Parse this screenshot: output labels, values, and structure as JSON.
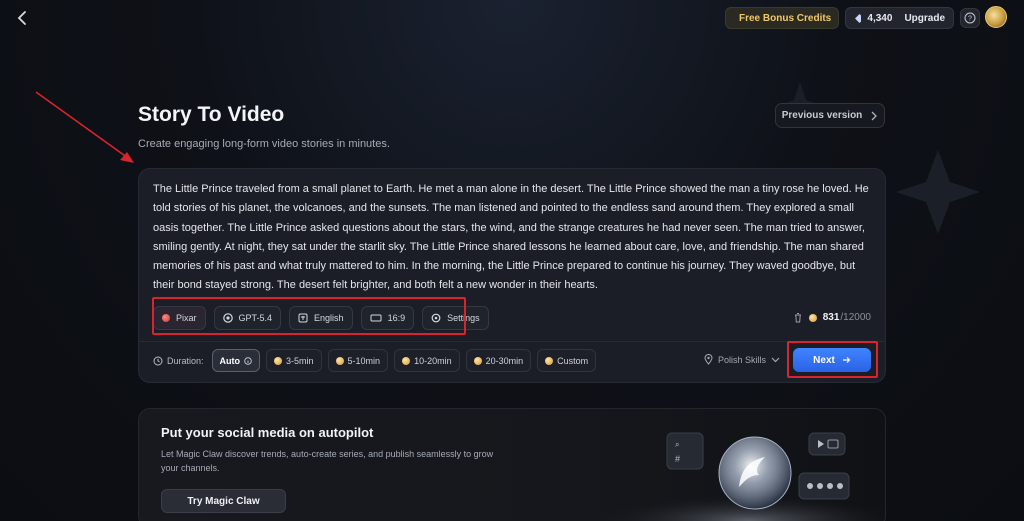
{
  "topbar": {
    "bonus_label": "Free Bonus Credits",
    "credits_value": "4,340",
    "upgrade_label": "Upgrade"
  },
  "header": {
    "title": "Story To Video",
    "subtitle": "Create engaging long-form video stories in minutes.",
    "previous_version_label": "Previous version"
  },
  "editor": {
    "story_text": "The Little Prince traveled from a small planet to Earth. He met a man alone in the desert. The Little Prince showed the man a tiny rose he loved. He told stories of his planet, the volcanoes, and the sunsets. The man listened and pointed to the endless sand around them. They explored a small oasis together. The Little Prince asked questions about the stars, the wind, and the strange creatures he had never seen. The man tried to answer, smiling gently. At night, they sat under the starlit sky. The Little Prince shared lessons he learned about care, love, and friendship. The man shared memories of his past and what truly mattered to him. In the morning, the Little Prince prepared to continue his journey. They waved goodbye, but their bond stayed strong. The desert felt brighter, and both felt a new wonder in their hearts.",
    "options": {
      "style": "Pixar",
      "model": "GPT-5.4",
      "language": "English",
      "aspect_ratio": "16:9",
      "settings": "Settings"
    },
    "char_used": "831",
    "char_max": "/12000",
    "duration_label": "Duration:",
    "durations": [
      "Auto",
      "3-5min",
      "5-10min",
      "10-20min",
      "20-30min",
      "Custom"
    ],
    "polish_skills_label": "Polish Skills",
    "next_label": "Next"
  },
  "promo": {
    "title": "Put your social media on autopilot",
    "description": "Let Magic Claw discover trends, auto-create series, and publish seamlessly to grow your channels.",
    "button_label": "Try Magic Claw"
  },
  "colors": {
    "accent_blue": "#2f6df0",
    "annotation_red": "#d9232d",
    "bonus_gold": "#f0c86a"
  }
}
